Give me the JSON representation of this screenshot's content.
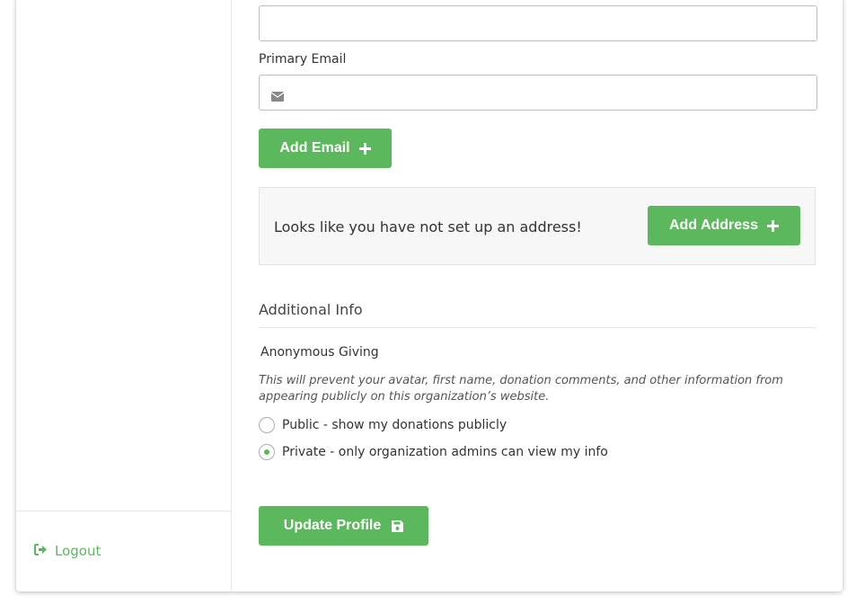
{
  "form": {
    "primary_email_label": "Primary Email",
    "add_email_label": "Add Email",
    "address_empty_text": "Looks like you have not set up an address!",
    "add_address_label": "Add Address",
    "additional_info_title": "Additional Info",
    "anonymous_giving_label": "Anonymous Giving",
    "anonymous_giving_note": "This will prevent your avatar, first name, donation comments, and other information from appearing publicly on this organization’s website.",
    "radio_public_label": "Public - show my donations publicly",
    "radio_private_label": "Private - only organization admins can view my info",
    "selected_option": "private",
    "update_profile_label": "Update Profile"
  },
  "sidebar": {
    "logout_label": "Logout"
  },
  "colors": {
    "accent": "#5cb85c"
  }
}
